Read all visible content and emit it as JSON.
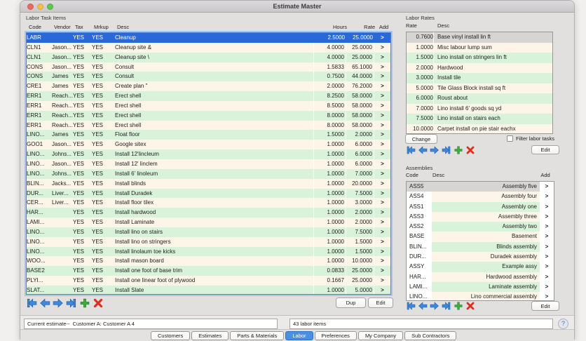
{
  "window": {
    "title": "Estimate Master"
  },
  "colors": {
    "selected_row_blue": "#2a68d9",
    "row_green": "#d9f3da",
    "row_cream": "#fdf5e8",
    "selected_gray": "#d6d5d3",
    "active_tab_blue": "#4a90e2",
    "nav_blue": "#3f87d9",
    "nav_green": "#3cae3f",
    "nav_red": "#dd2f1f"
  },
  "labor_tasks": {
    "panel_label": "Labor Task Items",
    "columns": [
      "Code",
      "Vendor",
      "Tax",
      "Mrkup",
      "Desc",
      "Hours",
      "Rate",
      "Add"
    ],
    "selected_index": 0,
    "add_glyph": ">",
    "dup_label": "Dup",
    "edit_label": "Edit",
    "rows": [
      {
        "code": "LABR",
        "vendor": "",
        "tax": "YES",
        "mrkup": "YES",
        "desc": "Cleanup",
        "hours": "2.5000",
        "rate": "25.0000"
      },
      {
        "code": "CLN1",
        "vendor": "Jason...",
        "tax": "YES",
        "mrkup": "YES",
        "desc": "Cleanup site &",
        "hours": "4.0000",
        "rate": "25.0000"
      },
      {
        "code": "CLN1",
        "vendor": "Jason...",
        "tax": "YES",
        "mrkup": "YES",
        "desc": "Cleanup site \\",
        "hours": "4.0000",
        "rate": "25.0000"
      },
      {
        "code": "CONS",
        "vendor": "Jason...",
        "tax": "YES",
        "mrkup": "YES",
        "desc": "Consult",
        "hours": "1.5833",
        "rate": "65.1000"
      },
      {
        "code": "CONS",
        "vendor": "James",
        "tax": "YES",
        "mrkup": "YES",
        "desc": "Consult",
        "hours": "0.7500",
        "rate": "44.0000"
      },
      {
        "code": "CRE1",
        "vendor": "James",
        "tax": "YES",
        "mrkup": "YES",
        "desc": "Create plan \"",
        "hours": "2.0000",
        "rate": "76.2000"
      },
      {
        "code": "ERR1",
        "vendor": "Reach...",
        "tax": "YES",
        "mrkup": "YES",
        "desc": "Erect shell",
        "hours": "8.2500",
        "rate": "58.0000"
      },
      {
        "code": "ERR1",
        "vendor": "Reach...",
        "tax": "YES",
        "mrkup": "YES",
        "desc": "Erect shell",
        "hours": "8.5000",
        "rate": "58.0000"
      },
      {
        "code": "ERR1",
        "vendor": "Reach...",
        "tax": "YES",
        "mrkup": "YES",
        "desc": "Erect shell",
        "hours": "8.0000",
        "rate": "58.0000"
      },
      {
        "code": "ERR1",
        "vendor": "Reach...",
        "tax": "YES",
        "mrkup": "YES",
        "desc": "Erect shell",
        "hours": "8.0000",
        "rate": "58.0000"
      },
      {
        "code": "LINO...",
        "vendor": "James",
        "tax": "YES",
        "mrkup": "YES",
        "desc": "Float floor",
        "hours": "1.5000",
        "rate": "2.0000"
      },
      {
        "code": "GOO1",
        "vendor": "Jason...",
        "tax": "YES",
        "mrkup": "YES",
        "desc": "Google sitex",
        "hours": "1.0000",
        "rate": "6.0000"
      },
      {
        "code": "LINO...",
        "vendor": "Johns...",
        "tax": "YES",
        "mrkup": "YES",
        "desc": "Install  12'lincleum",
        "hours": "1.0000",
        "rate": "6.0000"
      },
      {
        "code": "LINO...",
        "vendor": "Jason...",
        "tax": "YES",
        "mrkup": "YES",
        "desc": "Install 12' linclem",
        "hours": "1.0000",
        "rate": "6.0000"
      },
      {
        "code": "LINO...",
        "vendor": "Johns...",
        "tax": "YES",
        "mrkup": "YES",
        "desc": "Install 6' linoleum",
        "hours": "1.0000",
        "rate": "7.0000"
      },
      {
        "code": "BLIN...",
        "vendor": "Jacks...",
        "tax": "YES",
        "mrkup": "YES",
        "desc": "Install blinds",
        "hours": "1.0000",
        "rate": "20.0000"
      },
      {
        "code": "DUR...",
        "vendor": "Liver...",
        "tax": "YES",
        "mrkup": "YES",
        "desc": "Install Duradek",
        "hours": "1.0000",
        "rate": "7.5000"
      },
      {
        "code": "CER...",
        "vendor": "Liver...",
        "tax": "YES",
        "mrkup": "YES",
        "desc": "Install floor tilex",
        "hours": "1.0000",
        "rate": "3.0000"
      },
      {
        "code": "HAR...",
        "vendor": "",
        "tax": "YES",
        "mrkup": "YES",
        "desc": "Install hardwood",
        "hours": "1.0000",
        "rate": "2.0000"
      },
      {
        "code": "LAMI...",
        "vendor": "",
        "tax": "YES",
        "mrkup": "YES",
        "desc": "Install Laminate",
        "hours": "1.0000",
        "rate": "2.0000"
      },
      {
        "code": "LINO...",
        "vendor": "",
        "tax": "YES",
        "mrkup": "YES",
        "desc": "Install lino on stairs",
        "hours": "1.0000",
        "rate": "7.5000"
      },
      {
        "code": "LINO...",
        "vendor": "",
        "tax": "YES",
        "mrkup": "YES",
        "desc": "Install lino on stringers",
        "hours": "1.0000",
        "rate": "1.5000"
      },
      {
        "code": "LINO...",
        "vendor": "",
        "tax": "YES",
        "mrkup": "YES",
        "desc": "Install linolaum toe kicks",
        "hours": "1.0000",
        "rate": "1.5000"
      },
      {
        "code": "WOO...",
        "vendor": "",
        "tax": "YES",
        "mrkup": "YES",
        "desc": "Install mason board",
        "hours": "1.0000",
        "rate": "10.0000"
      },
      {
        "code": "BASE2",
        "vendor": "",
        "tax": "YES",
        "mrkup": "YES",
        "desc": "Install one foot of base trim",
        "hours": "0.0833",
        "rate": "25.0000"
      },
      {
        "code": "PLYI...",
        "vendor": "",
        "tax": "YES",
        "mrkup": "YES",
        "desc": "Install one linear foot of plywood",
        "hours": "0.1667",
        "rate": "25.0000"
      },
      {
        "code": "SLAT...",
        "vendor": "",
        "tax": "YES",
        "mrkup": "YES",
        "desc": "Install Slate",
        "hours": "1.0000",
        "rate": "5.0000"
      }
    ]
  },
  "labor_rates": {
    "panel_label": "Labor Rates",
    "columns": [
      "Rate",
      "Desc"
    ],
    "selected_index": 0,
    "change_label": "Change",
    "filter_label": "Filter labor tasks",
    "filter_checked": false,
    "edit_label": "Edit",
    "rows": [
      {
        "rate": "0.7600",
        "desc": "Base vinyl install lin ft"
      },
      {
        "rate": "1.0000",
        "desc": "Misc labour lump sum"
      },
      {
        "rate": "1.5000",
        "desc": "Lino install on stringers lin ft"
      },
      {
        "rate": "2.0000",
        "desc": "Hardwood"
      },
      {
        "rate": "3.0000",
        "desc": "Install tile"
      },
      {
        "rate": "5.0000",
        "desc": "Tile Glass Block install sq ft"
      },
      {
        "rate": "6.0000",
        "desc": "Roust about"
      },
      {
        "rate": "7.0000",
        "desc": "Lino install 6' goods sq yd"
      },
      {
        "rate": "7.5000",
        "desc": "Lino install on stairs each"
      },
      {
        "rate": "10.0000",
        "desc": "Carpet install on pie stair eachx"
      }
    ]
  },
  "assemblies": {
    "panel_label": "Assemblies",
    "columns": [
      "Code",
      "Desc",
      "Add"
    ],
    "selected_index": 0,
    "add_glyph": ">",
    "edit_label": "Edit",
    "rows": [
      {
        "code": "ASS5",
        "desc": "Assembly five"
      },
      {
        "code": "ASS4",
        "desc": "Assembly four"
      },
      {
        "code": "ASS1",
        "desc": "Assembly one"
      },
      {
        "code": "ASS3",
        "desc": "Assembly three"
      },
      {
        "code": "ASS2",
        "desc": "Assembly two"
      },
      {
        "code": "BASE",
        "desc": "Basement"
      },
      {
        "code": "BLIN...",
        "desc": "Blinds assembly"
      },
      {
        "code": "DUR...",
        "desc": "Duradek assembly"
      },
      {
        "code": "ASSY",
        "desc": "Example assy"
      },
      {
        "code": "HAR...",
        "desc": "Hardwood assembly"
      },
      {
        "code": "LAMI...",
        "desc": "Laminate assembly"
      },
      {
        "code": "LINO...",
        "desc": "Lino commercial assembly"
      }
    ]
  },
  "status": {
    "estimate_field": "Current estimate--  Customer A: Customer A 4",
    "count_field": "43 labor items",
    "help_label": "?"
  },
  "tabs": [
    "Customers",
    "Estimates",
    "Parts & Materials",
    "Labor",
    "Preferences",
    "My Company",
    "Sub Contractors"
  ],
  "active_tab": "Labor"
}
